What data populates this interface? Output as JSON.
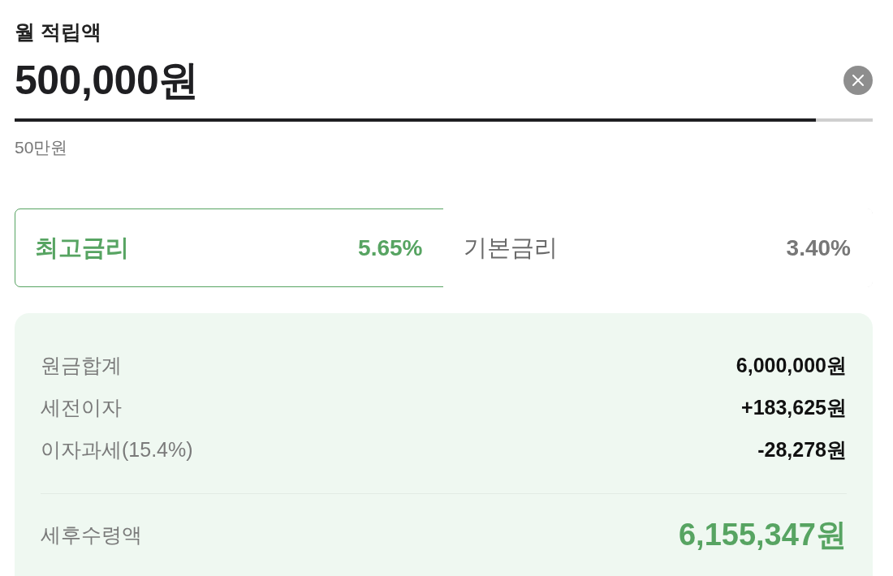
{
  "amount": {
    "label": "월 적립액",
    "value": "500,000원",
    "level": 0.934,
    "hint": "50만원"
  },
  "rate_tabs": [
    {
      "label": "최고금리",
      "rate": "5.65%",
      "selected": true
    },
    {
      "label": "기본금리",
      "rate": "3.40%",
      "selected": false
    }
  ],
  "summary": {
    "rows": [
      {
        "label": "원금합계",
        "value": "6,000,000원"
      },
      {
        "label": "세전이자",
        "value": "+183,625원"
      },
      {
        "label": "이자과세(15.4%)",
        "value": "-28,278원"
      }
    ],
    "total": {
      "label": "세후수령액",
      "value": "6,155,347원"
    }
  }
}
